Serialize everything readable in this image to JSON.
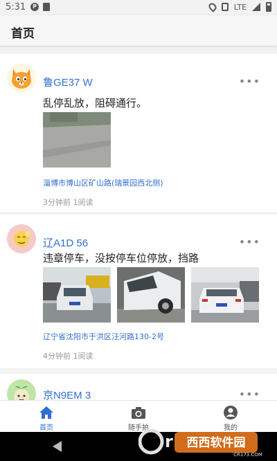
{
  "status_bar": {
    "time": "5:31",
    "network": "LTE"
  },
  "app_bar": {
    "title": "首页"
  },
  "posts": [
    {
      "plate": "鲁GE37  W",
      "description": "乱停乱放，阻碍通行。",
      "address": "淄博市博山区矿山路(瑞景园西北侧)",
      "meta": "3分钟前 1阅读",
      "more": "•••"
    },
    {
      "plate": "辽A1D  56",
      "description": "违章停车，没按停车位停放，挡路",
      "address": "辽宁省沈阳市于洪区汪河路130-2号",
      "meta": "4分钟前 1阅读",
      "more": "•••"
    },
    {
      "plate": "京N9EM  3",
      "more": "•••"
    }
  ],
  "bottom_nav": {
    "items": [
      {
        "label": "首页",
        "icon": "home-icon",
        "active": true
      },
      {
        "label": "随手拍",
        "icon": "camera-icon",
        "active": false
      },
      {
        "label": "我的",
        "icon": "profile-icon",
        "active": false
      }
    ]
  },
  "watermark": {
    "text": "西西软件园",
    "sub": "CR173.COM"
  },
  "colors": {
    "accent": "#2f6fd1",
    "text": "#222222",
    "muted": "#999999",
    "background": "#f2f2f2"
  }
}
